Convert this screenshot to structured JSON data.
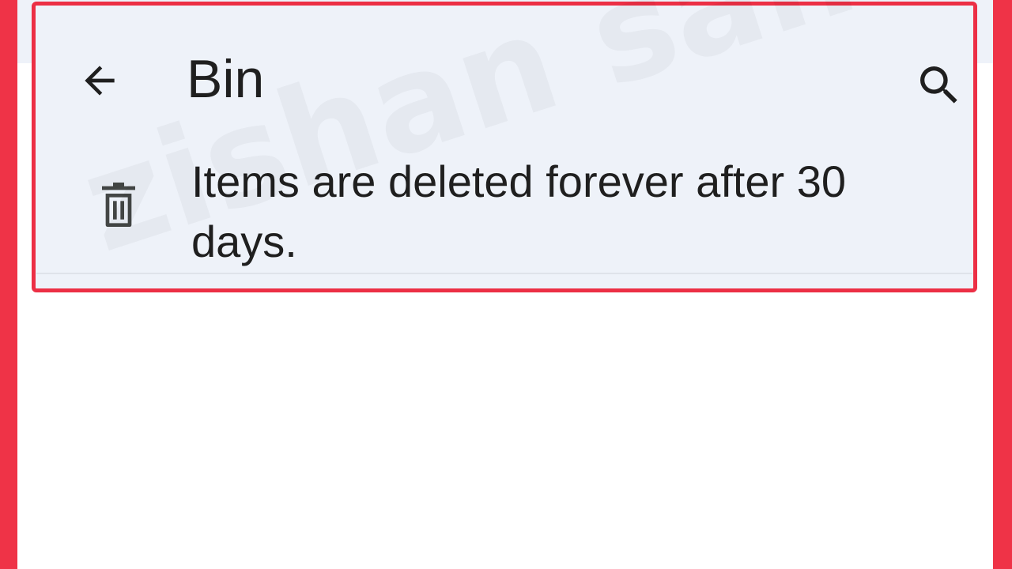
{
  "app_bar": {
    "title": "Bin",
    "back_icon": "arrow-back-icon",
    "search_icon": "search-icon"
  },
  "notice": {
    "icon": "trash-icon",
    "text": "Items are deleted forever after 30 days."
  },
  "watermark": {
    "text": "zishan saifi"
  },
  "colors": {
    "frame": "#ef3347",
    "highlight_border": "#ec2f45",
    "header_bg": "#eef2f9",
    "content_bg": "#ffffff",
    "text": "#1f1f1f"
  }
}
